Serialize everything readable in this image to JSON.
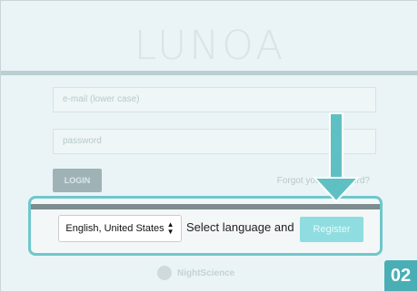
{
  "app": {
    "brand": "LUNOA"
  },
  "form": {
    "email_placeholder": "e-mail (lower case)",
    "password_placeholder": "password",
    "login_label": "LOGIN",
    "forgot_label": "Forgot your password?"
  },
  "footer": {
    "logo_text": "NightScience"
  },
  "language_bar": {
    "selected_language": "English, United States",
    "instruction": "Select language and",
    "register_label": "Register"
  },
  "annotation": {
    "step": "02",
    "highlight_color": "#6fc7cc",
    "arrow_color": "#5fc0c4"
  }
}
